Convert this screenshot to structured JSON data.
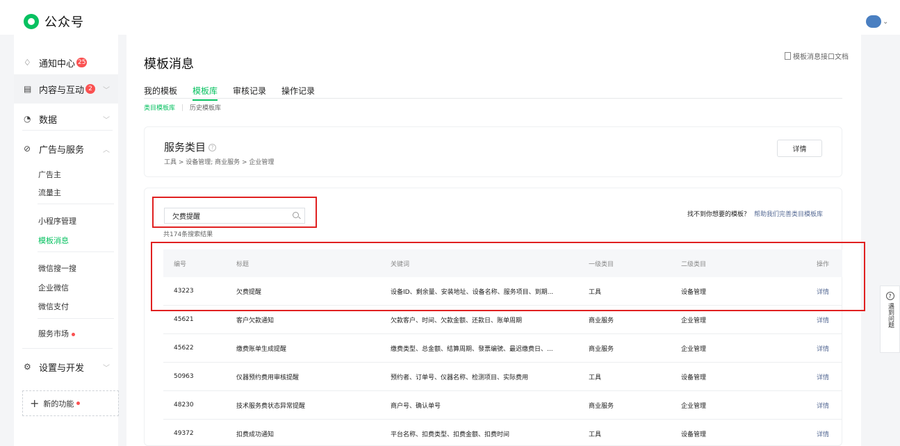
{
  "app": {
    "name": "公众号"
  },
  "sidebar": {
    "notifications": {
      "label": "通知中心",
      "badge": "25"
    },
    "content": {
      "label": "内容与互动",
      "badge": "2"
    },
    "data": {
      "label": "数据"
    },
    "ads": {
      "label": "广告与服务",
      "items": [
        "广告主",
        "流量主",
        "小程序管理",
        "模板消息",
        "微信搜一搜",
        "企业微信",
        "微信支付",
        "服务市场"
      ]
    },
    "settings": {
      "label": "设置与开发"
    },
    "new_features": {
      "label": "新的功能"
    }
  },
  "page": {
    "title": "模板消息",
    "doc_link": "模板消息接口文档",
    "tabs": [
      "我的模板",
      "模板库",
      "审核记录",
      "操作记录"
    ],
    "active_tab": "模板库",
    "subtabs": [
      "类目模板库",
      "历史模板库"
    ]
  },
  "service_card": {
    "title": "服务类目",
    "path": "工具 > 设备管理; 商业服务 > 企业管理",
    "detail_button": "详情"
  },
  "search": {
    "value": "欠费提醒",
    "result_count": "共174条搜索结果",
    "not_found_text": "找不到你想要的模板？",
    "help_link": "帮助我们完善类目模板库"
  },
  "table": {
    "headers": [
      "编号",
      "标题",
      "关键词",
      "一级类目",
      "二级类目",
      "操作"
    ],
    "rows": [
      {
        "id": "43223",
        "title": "欠费提醒",
        "keywords": "设备ID、剩余量、安装地址、设备名称、服务项目、到期...",
        "cat1": "工具",
        "cat2": "设备管理",
        "action": "详情"
      },
      {
        "id": "45621",
        "title": "客户欠款通知",
        "keywords": "欠款客户、时间、欠款金额、还款日、账单周期",
        "cat1": "商业服务",
        "cat2": "企业管理",
        "action": "详情"
      },
      {
        "id": "45622",
        "title": "缴费账单生成提醒",
        "keywords": "缴费类型、总金额、结算周期、發票编號、最迟缴费日、...",
        "cat1": "商业服务",
        "cat2": "企业管理",
        "action": "详情"
      },
      {
        "id": "50963",
        "title": "仪器预约费用审核提醒",
        "keywords": "预约者、订单号、仪器名称、检测项目、实际费用",
        "cat1": "工具",
        "cat2": "设备管理",
        "action": "详情"
      },
      {
        "id": "48230",
        "title": "技术服务费状态异常提醒",
        "keywords": "商户号、确认单号",
        "cat1": "商业服务",
        "cat2": "企业管理",
        "action": "详情"
      },
      {
        "id": "49372",
        "title": "扣费成功通知",
        "keywords": "平台名称、扣费类型、扣费金额、扣费时间",
        "cat1": "工具",
        "cat2": "设备管理",
        "action": "详情"
      }
    ]
  },
  "float_help": {
    "label": "遇到问题"
  },
  "colors": {
    "accent": "#07c160",
    "badge": "#fa5151",
    "link": "#576b95",
    "highlight": "#e02020"
  }
}
